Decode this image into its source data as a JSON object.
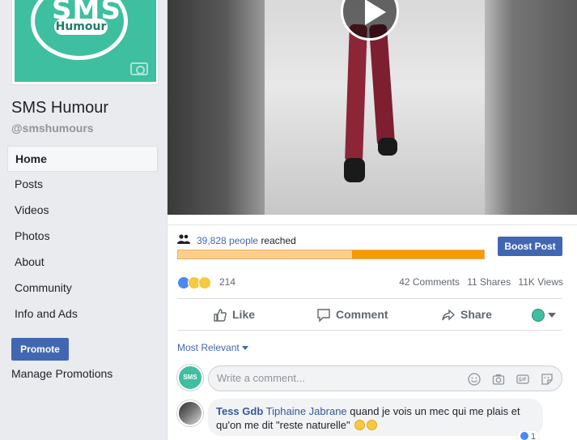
{
  "page": {
    "logo_text": "SMS",
    "logo_badge": "Humour",
    "name": "SMS Humour",
    "handle": "@smshumours"
  },
  "nav": {
    "items": [
      {
        "label": "Home",
        "active": true
      },
      {
        "label": "Posts"
      },
      {
        "label": "Videos"
      },
      {
        "label": "Photos"
      },
      {
        "label": "About"
      },
      {
        "label": "Community"
      },
      {
        "label": "Info and Ads"
      }
    ]
  },
  "promote": {
    "button": "Promote",
    "manage": "Manage Promotions"
  },
  "reach": {
    "count": "39,828",
    "people_label": "people",
    "suffix": "reached",
    "boost_button": "Boost Post",
    "paid_fraction": 0.43
  },
  "stats": {
    "reactions_count": "214",
    "comments": "42 Comments",
    "shares": "11 Shares",
    "views": "11K Views"
  },
  "actions": {
    "like": "Like",
    "comment": "Comment",
    "share": "Share"
  },
  "comments": {
    "sort_label": "Most Relevant",
    "input_placeholder": "Write a comment...",
    "avatar_text": "SMS",
    "list": [
      {
        "author": "Tess Gdb",
        "tag": "Tiphaine Jabrane",
        "text": "quand je vois un mec qui me plais et qu'on me dit \"reste naturelle\"",
        "reaction_count": "1"
      }
    ]
  },
  "colors": {
    "brand_blue": "#4267b2",
    "teal": "#3ebfa0",
    "reach_orange": "#f69a00"
  }
}
